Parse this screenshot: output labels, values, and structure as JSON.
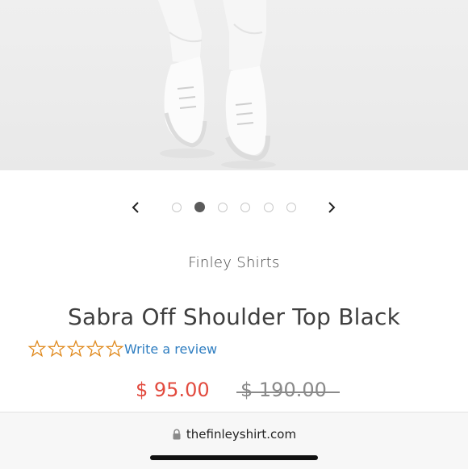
{
  "gallery": {
    "prev_icon": "chevron-left-icon",
    "next_icon": "chevron-right-icon",
    "dots": [
      {
        "active": false
      },
      {
        "active": true
      },
      {
        "active": false
      },
      {
        "active": false
      },
      {
        "active": false
      },
      {
        "active": false
      }
    ]
  },
  "product": {
    "vendor": "Finley Shirts",
    "title": "Sabra Off Shoulder Top Black",
    "rating": {
      "stars": 0,
      "max_stars": 5,
      "review_link": "Write a review"
    },
    "price": "$ 95.00",
    "compare_at_price": "$ 190.00"
  },
  "browser": {
    "url": "thefinleyshirt.com",
    "lock_icon": "lock-icon"
  },
  "colors": {
    "price": "#e24b3f",
    "star_outline": "#e08a1e",
    "link": "#2f7ec1"
  }
}
